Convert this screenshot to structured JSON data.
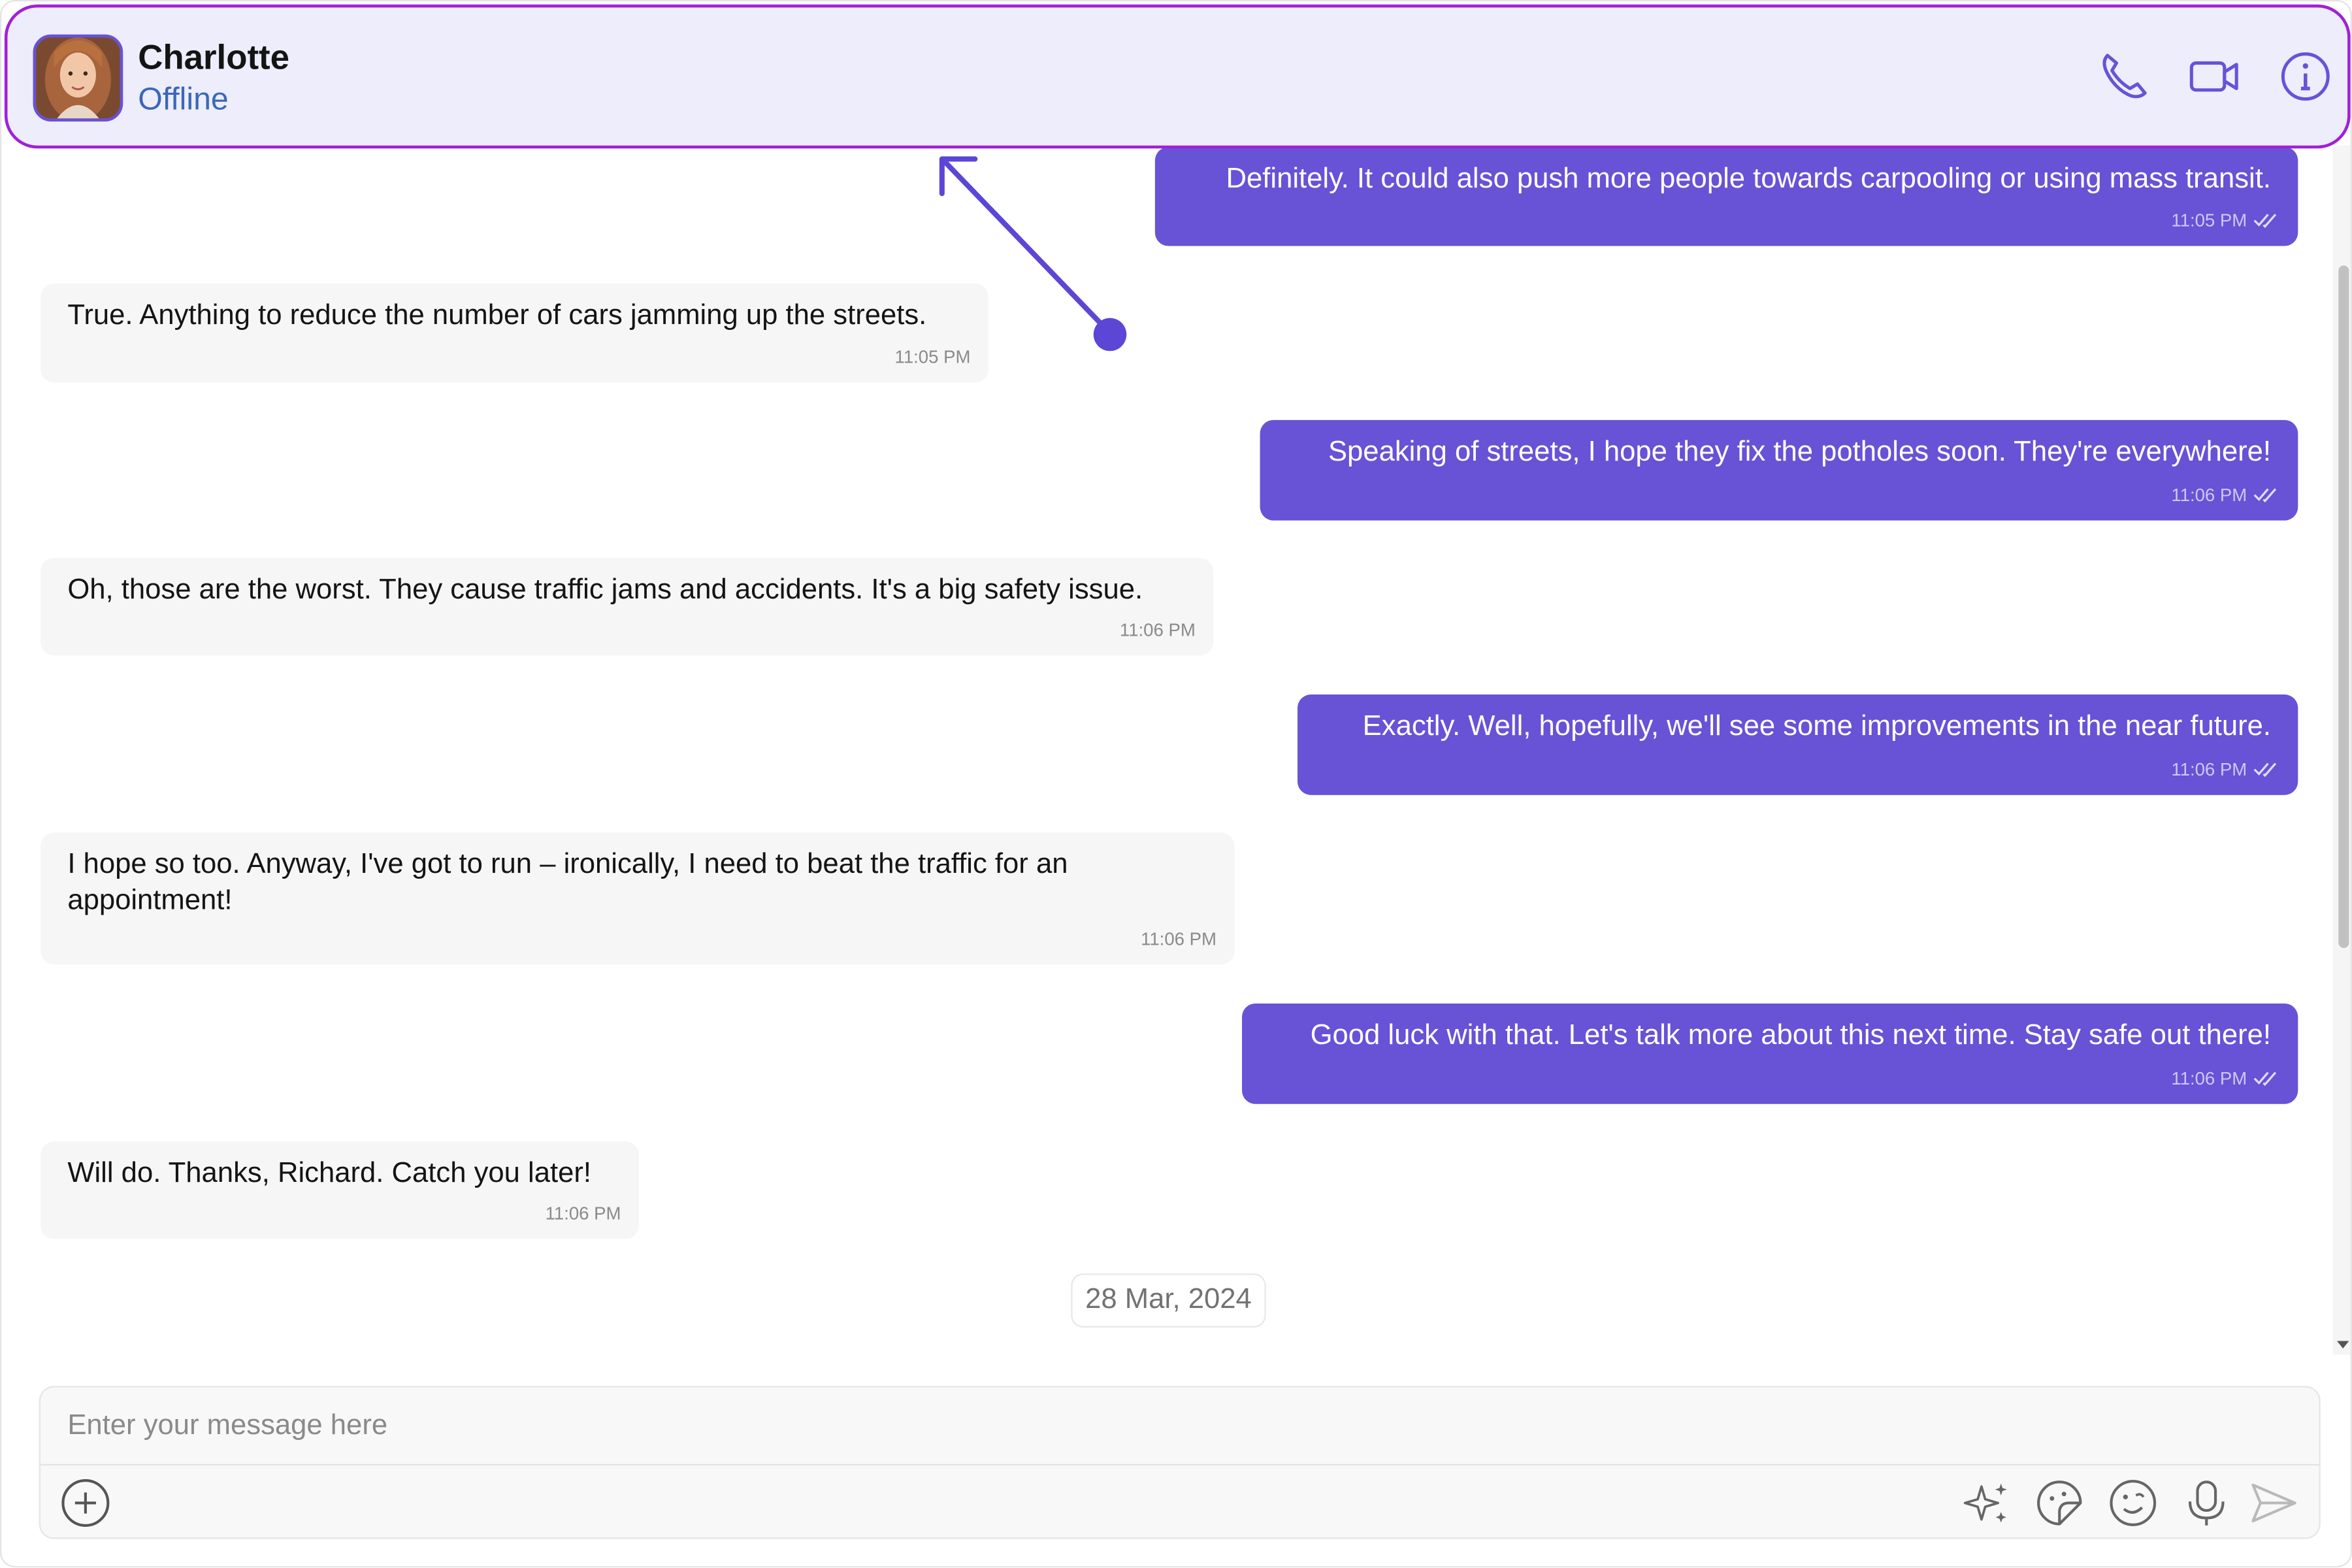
{
  "header": {
    "name": "Charlotte",
    "status": "Offline",
    "avatar_icon": "user-avatar-photo",
    "actions": [
      "phone-icon",
      "video-camera-icon",
      "info-icon"
    ]
  },
  "messages": [
    {
      "direction": "out",
      "text": "Definitely. It could also push more people towards carpooling or using mass transit.",
      "time": "11:05 PM",
      "receipt": "double-check-icon"
    },
    {
      "direction": "in",
      "text": "True. Anything to reduce the number of cars jamming up the streets.",
      "time": "11:05 PM"
    },
    {
      "direction": "out",
      "text": "Speaking of streets, I hope they fix the potholes soon. They're everywhere!",
      "time": "11:06 PM",
      "receipt": "double-check-icon"
    },
    {
      "direction": "in",
      "text": "Oh, those are the worst. They cause traffic jams and accidents. It's a big safety issue.",
      "time": "11:06 PM"
    },
    {
      "direction": "out",
      "text": "Exactly. Well, hopefully, we'll see some improvements in the near future.",
      "time": "11:06 PM",
      "receipt": "double-check-icon"
    },
    {
      "direction": "in",
      "text": "I hope so too. Anyway, I've got to run – ironically, I need to beat the traffic for an appointment!",
      "time": "11:06 PM"
    },
    {
      "direction": "out",
      "text": "Good luck with that. Let's talk more about this next time. Stay safe out there!",
      "time": "11:06 PM",
      "receipt": "double-check-icon"
    },
    {
      "direction": "in",
      "text": "Will do. Thanks, Richard. Catch you later!",
      "time": "11:06 PM"
    }
  ],
  "date_separator": "28 Mar, 2024",
  "composer": {
    "placeholder": "Enter your message here",
    "value": "",
    "left_icons": [
      "add-attachment-icon"
    ],
    "right_icons": [
      "ai-sparkle-icon",
      "sticker-icon",
      "emoji-icon",
      "microphone-icon",
      "send-icon"
    ]
  },
  "colors": {
    "accent": "#6852d6",
    "header_bg": "#ededfc",
    "header_border": "#a020d8",
    "incoming_bg": "#f6f6f6",
    "status": "#3b67b8",
    "annotation": "#5b46d6"
  }
}
